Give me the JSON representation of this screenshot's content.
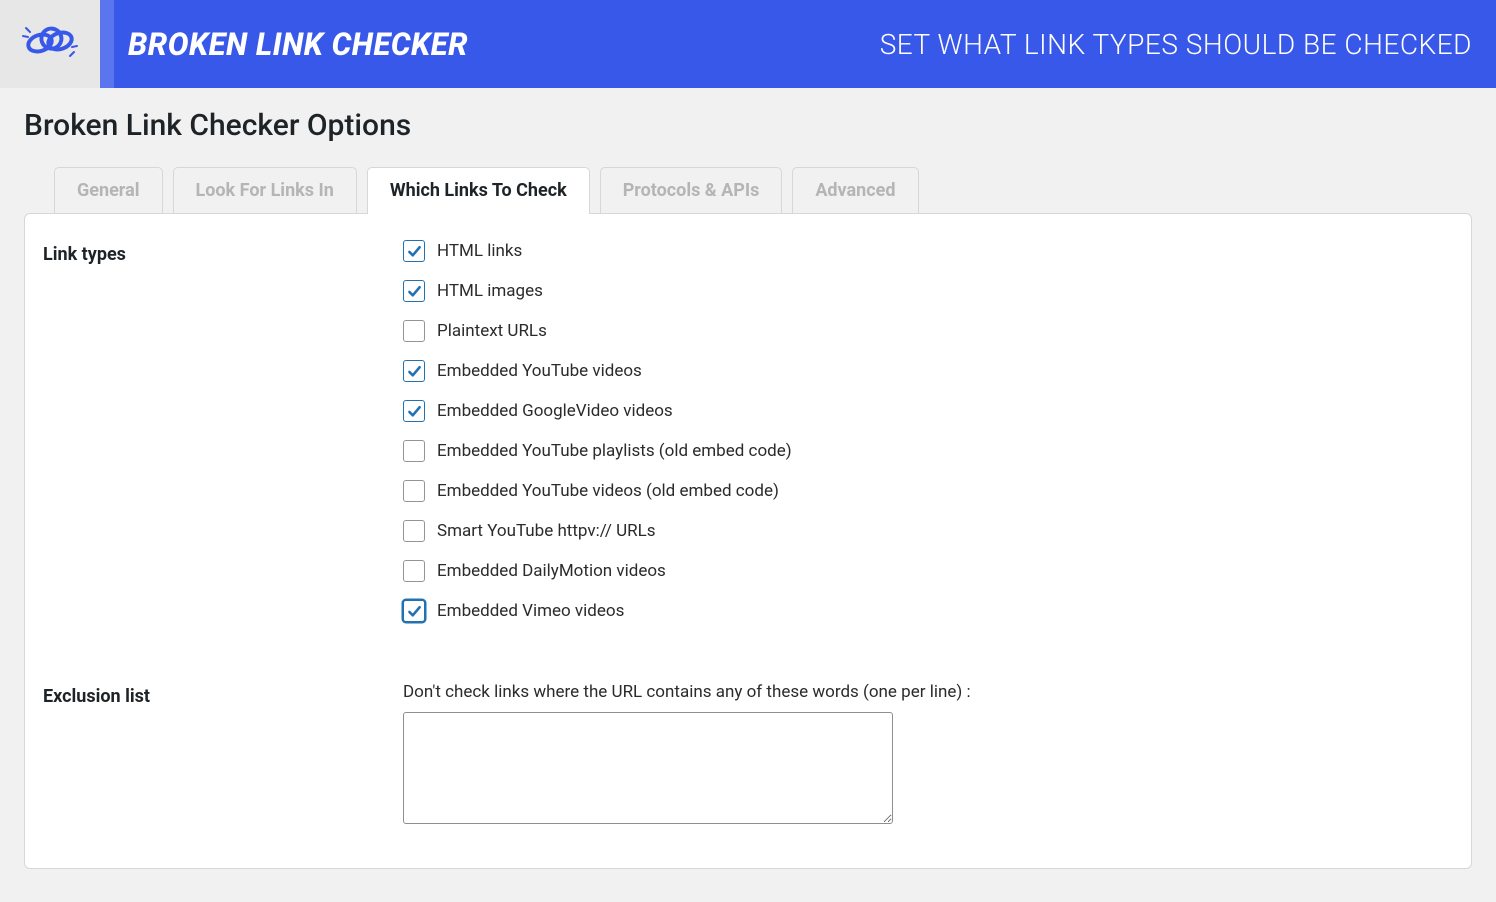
{
  "header": {
    "app_title": "BROKEN LINK CHECKER",
    "subtitle": "SET WHAT LINK TYPES SHOULD BE CHECKED"
  },
  "page_title": "Broken Link Checker Options",
  "tabs": [
    {
      "label": "General",
      "active": false
    },
    {
      "label": "Look For Links In",
      "active": false
    },
    {
      "label": "Which Links To Check",
      "active": true
    },
    {
      "label": "Protocols & APIs",
      "active": false
    },
    {
      "label": "Advanced",
      "active": false
    }
  ],
  "section_link_types": {
    "label": "Link types",
    "items": [
      {
        "label": "HTML links",
        "checked": true
      },
      {
        "label": "HTML images",
        "checked": true
      },
      {
        "label": "Plaintext URLs",
        "checked": false
      },
      {
        "label": "Embedded YouTube videos",
        "checked": true
      },
      {
        "label": "Embedded GoogleVideo videos",
        "checked": true
      },
      {
        "label": "Embedded YouTube playlists (old embed code)",
        "checked": false
      },
      {
        "label": "Embedded YouTube videos (old embed code)",
        "checked": false
      },
      {
        "label": "Smart YouTube httpv:// URLs",
        "checked": false
      },
      {
        "label": "Embedded DailyMotion videos",
        "checked": false
      },
      {
        "label": "Embedded Vimeo videos",
        "checked": true,
        "highlighted": true
      }
    ]
  },
  "section_exclusion": {
    "label": "Exclusion list",
    "description": "Don't check links where the URL contains any of these words (one per line) :",
    "value": ""
  }
}
